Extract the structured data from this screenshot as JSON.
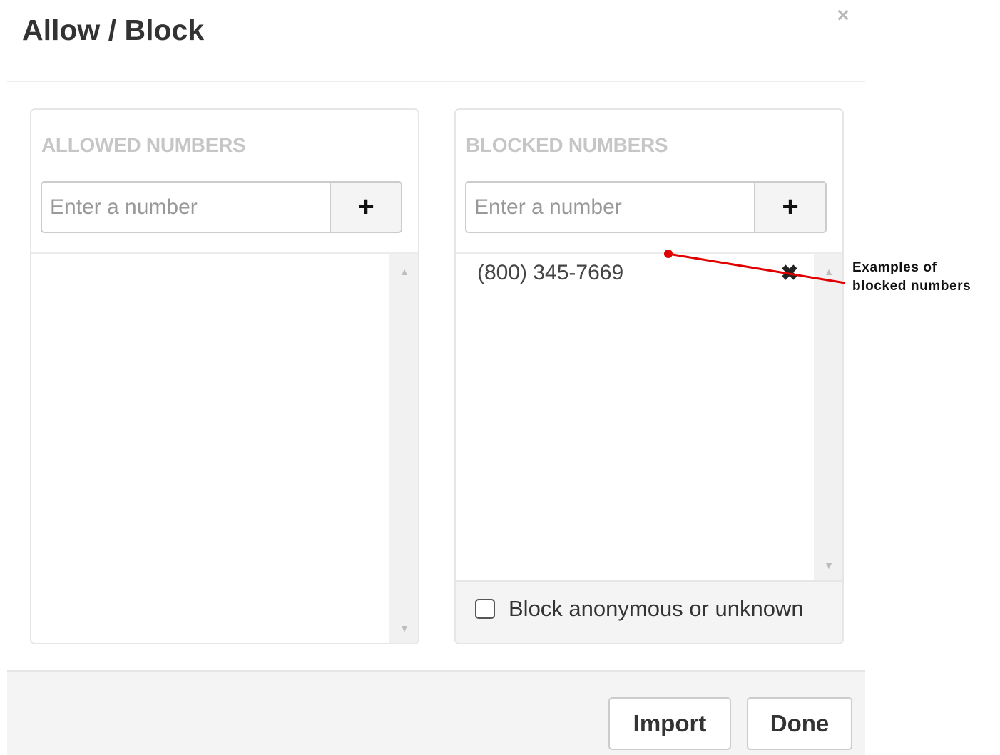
{
  "modal": {
    "title": "Allow / Block",
    "close_glyph": "×",
    "close_icon": "close-icon"
  },
  "allowed": {
    "heading": "ALLOWED NUMBERS",
    "input_placeholder": "Enter a number",
    "input_value": "",
    "add_glyph": "+",
    "items": []
  },
  "blocked": {
    "heading": "BLOCKED NUMBERS",
    "input_placeholder": "Enter a number",
    "input_value": "",
    "add_glyph": "+",
    "items": [
      {
        "number": "(800) 345-7669",
        "remove_glyph": "✖"
      }
    ],
    "block_anonymous_label": "Block anonymous or unknown",
    "block_anonymous_checked": false
  },
  "scroll": {
    "up_glyph": "▲",
    "down_glyph": "▼"
  },
  "annotation": {
    "line1": "Examples of",
    "line2": "blocked numbers",
    "color": "#e00000"
  },
  "footer": {
    "import_label": "Import",
    "done_label": "Done"
  }
}
